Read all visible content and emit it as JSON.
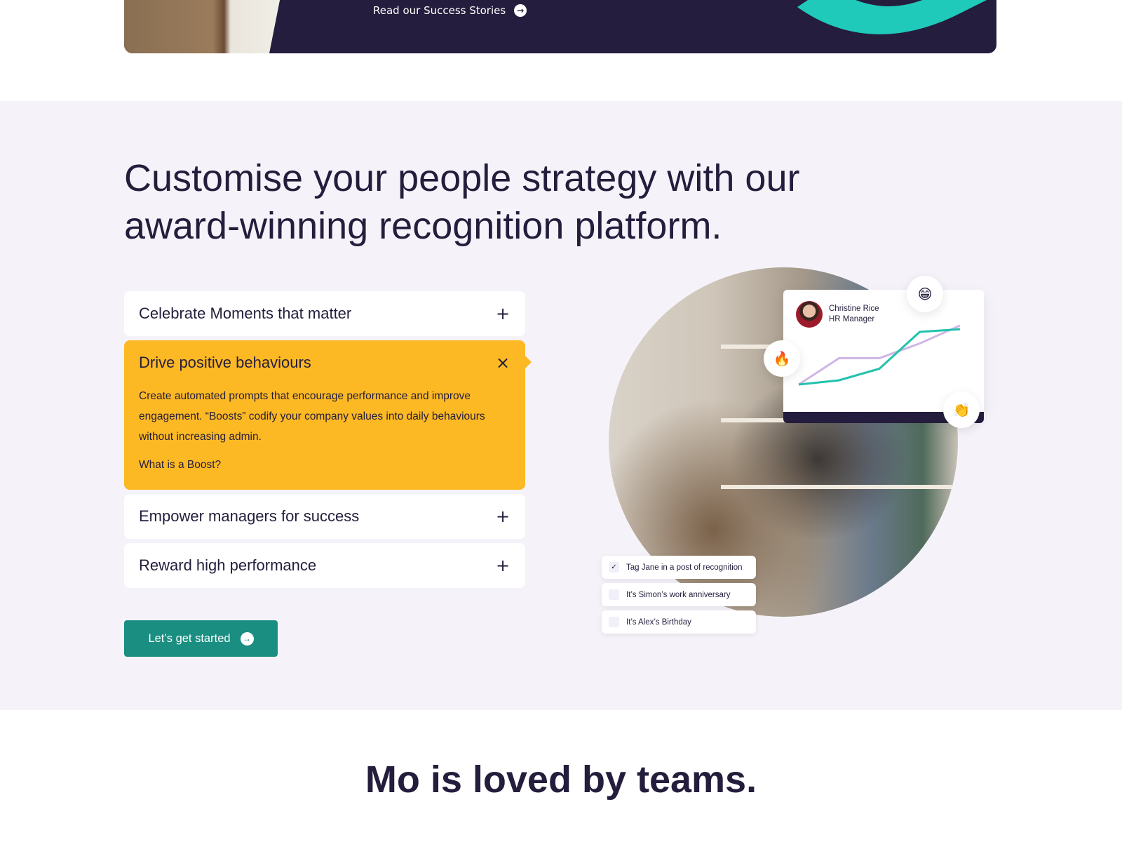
{
  "banner": {
    "link_label": "Read our Success Stories",
    "link_icon": "arrow-right-circle-icon",
    "accent_color": "#1fcabb",
    "background_color": "#251d3d"
  },
  "section": {
    "headline_line1": "Customise your people strategy with our",
    "headline_line2": "award-winning recognition platform.",
    "accordion": [
      {
        "title": "Celebrate Moments that matter",
        "icon": "+",
        "open": false
      },
      {
        "title": "Drive positive behaviours",
        "icon": "×",
        "open": true,
        "body": "Create automated prompts that encourage performance and improve engagement. “Boosts” codify your company values into daily behaviours without increasing admin.",
        "link": "What is a Boost?"
      },
      {
        "title": "Empower managers for success",
        "icon": "+",
        "open": false
      },
      {
        "title": "Reward high performance",
        "icon": "+",
        "open": false
      }
    ],
    "cta_label": "Let’s get started",
    "highlight_color": "#fdb924",
    "cta_color": "#1a8e80"
  },
  "illustration": {
    "person_name": "Christine Rice",
    "person_role": "HR Manager",
    "emojis": {
      "grin": "😁",
      "fire": "🔥",
      "clap": "👏"
    },
    "tasks": [
      {
        "label": "Tag Jane in a post of recognition",
        "checked": true,
        "mark": "✓"
      },
      {
        "label": "It’s Simon’s work anniversary",
        "checked": false,
        "mark": ""
      },
      {
        "label": "It’s Alex’s Birthday",
        "checked": false,
        "mark": ""
      }
    ],
    "trend_lines": {
      "teal": [
        0.0,
        0.08,
        0.3,
        1.0,
        1.05
      ],
      "lilac": [
        0.0,
        0.5,
        0.5,
        0.78,
        1.12
      ],
      "teal_color": "#22c2ad",
      "lilac_color": "#cfb6e6"
    }
  },
  "footer_heading": "Mo is loved by teams."
}
